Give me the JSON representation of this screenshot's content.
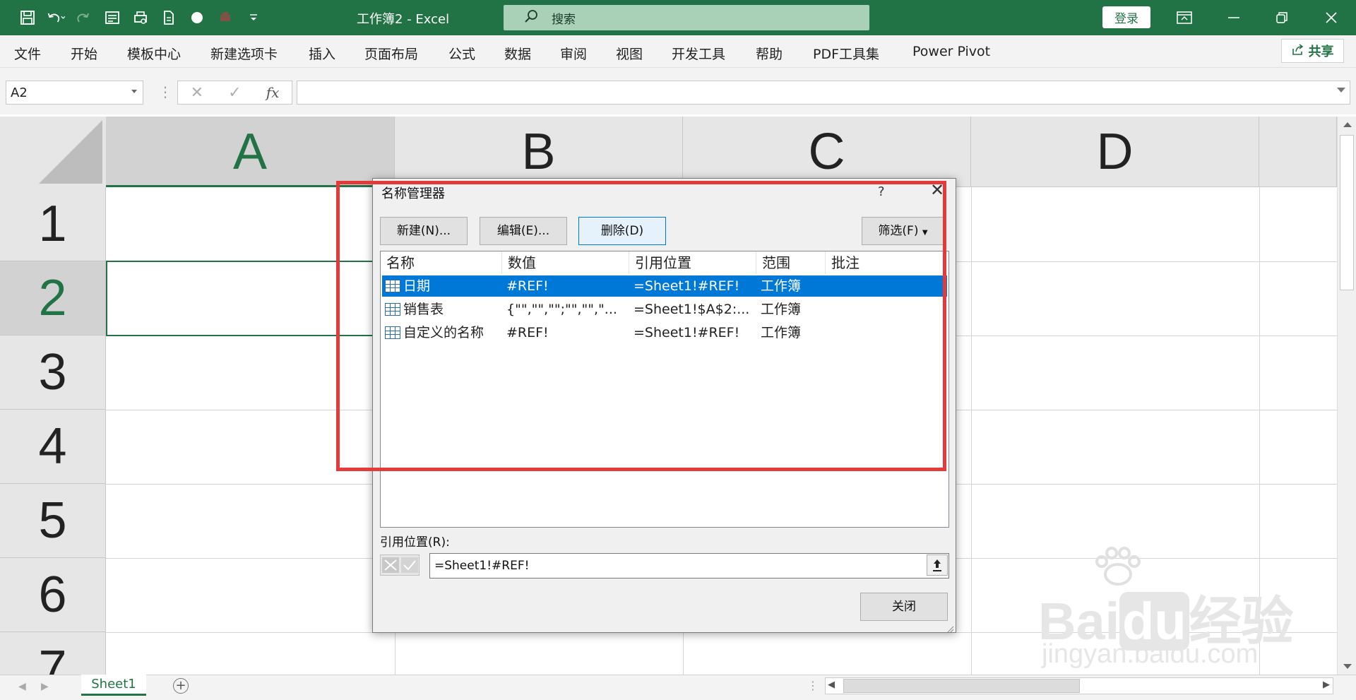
{
  "app": {
    "title": "工作簿2  -  Excel",
    "search_placeholder": "搜索",
    "login": "登录"
  },
  "menu": [
    "文件",
    "开始",
    "模板中心",
    "新建选项卡",
    "插入",
    "页面布局",
    "公式",
    "数据",
    "审阅",
    "视图",
    "开发工具",
    "帮助",
    "PDF工具集",
    "Power Pivot"
  ],
  "share": "共享",
  "formula_bar": {
    "name_box": "A2",
    "fx": "fx",
    "formula": ""
  },
  "sheet": {
    "columns": [
      "A",
      "B",
      "C",
      "D"
    ],
    "rows": [
      "1",
      "2",
      "3",
      "4",
      "5",
      "6",
      "7"
    ],
    "active_cell": "A2",
    "tab": "Sheet1"
  },
  "dialog": {
    "title": "名称管理器",
    "help": "?",
    "buttons": {
      "new": "新建(N)...",
      "edit": "编辑(E)...",
      "delete": "删除(D)",
      "filter": "筛选(F)",
      "close": "关闭"
    },
    "headers": [
      "名称",
      "数值",
      "引用位置",
      "范围",
      "批注"
    ],
    "rows": [
      {
        "name": "日期",
        "value": "#REF!",
        "ref": "=Sheet1!#REF!",
        "scope": "工作簿",
        "comment": ""
      },
      {
        "name": "销售表",
        "value": "{\"\",\"\",\"\";\"\",\"\",\"...",
        "ref": "=Sheet1!$A$2:...",
        "scope": "工作簿",
        "comment": ""
      },
      {
        "name": "自定义的名称",
        "value": "#REF!",
        "ref": "=Sheet1!#REF!",
        "scope": "工作簿",
        "comment": ""
      }
    ],
    "ref_label": "引用位置(R):",
    "ref_value": "=Sheet1!#REF!"
  },
  "watermark": {
    "brand": "Bai",
    "brand2": "du",
    "cn": "经验",
    "url": "jingyan.baidu.com"
  },
  "colors": {
    "excel_green": "#217346",
    "selection": "#0078d7",
    "highlight": "#e53a3a"
  }
}
